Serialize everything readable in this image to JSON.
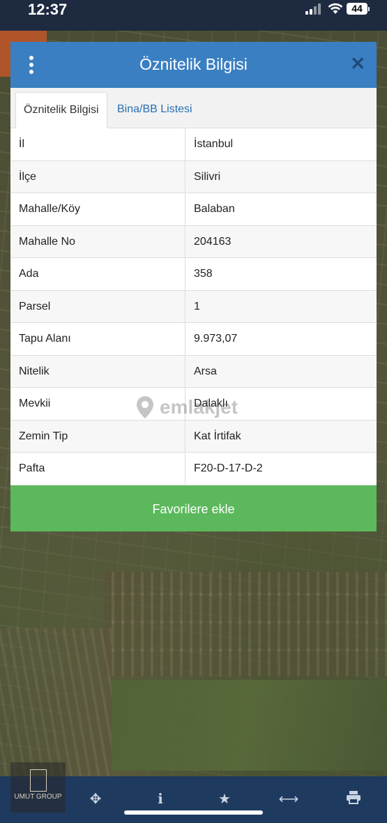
{
  "status_bar": {
    "time": "12:37",
    "battery": "44"
  },
  "dialog": {
    "title": "Öznitelik Bilgisi",
    "tabs": [
      {
        "label": "Öznitelik Bilgisi",
        "active": true
      },
      {
        "label": "Bina/BB Listesi",
        "active": false
      }
    ],
    "rows": [
      {
        "key": "İl",
        "value": "İstanbul"
      },
      {
        "key": "İlçe",
        "value": "Silivri"
      },
      {
        "key": "Mahalle/Köy",
        "value": "Balaban"
      },
      {
        "key": "Mahalle No",
        "value": "204163"
      },
      {
        "key": "Ada",
        "value": "358"
      },
      {
        "key": "Parsel",
        "value": "1"
      },
      {
        "key": "Tapu Alanı",
        "value": "9.973,07"
      },
      {
        "key": "Nitelik",
        "value": "Arsa"
      },
      {
        "key": "Mevkii",
        "value": "Dalaklı"
      },
      {
        "key": "Zemin Tip",
        "value": "Kat İrtifak"
      },
      {
        "key": "Pafta",
        "value": "F20-D-17-D-2"
      }
    ],
    "favorite_button": "Favorilere ekle"
  },
  "watermark": "emlakjet",
  "logo_text": "UMUT GROUP",
  "toolbar_icons": [
    "crosshair-icon",
    "info-icon",
    "star-icon",
    "measure-icon",
    "print-icon"
  ],
  "colors": {
    "header": "#3a7fc2",
    "favorite_button": "#5cb85c",
    "toolbar": "#1f3a5f"
  }
}
